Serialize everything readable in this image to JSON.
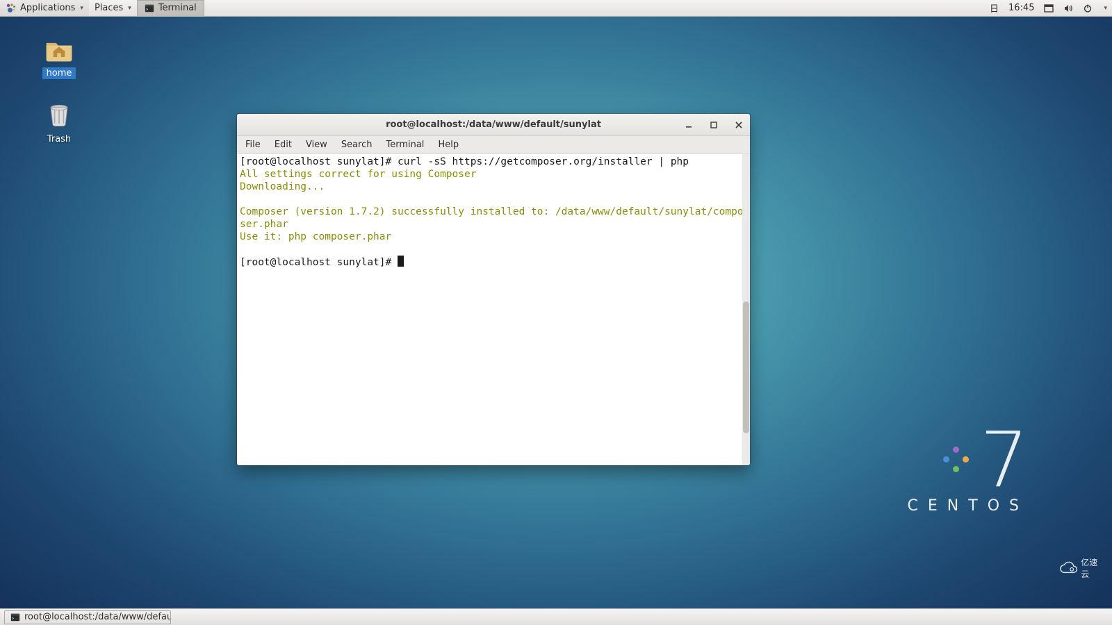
{
  "panel": {
    "applications": "Applications",
    "places": "Places",
    "top_task": "Terminal",
    "calendar_icon": "日",
    "clock": "16:45"
  },
  "desktop": {
    "home": "home",
    "trash": "Trash"
  },
  "brand": {
    "seven": "7",
    "name": "CENTOS"
  },
  "watermark": "亿速云",
  "window": {
    "title": "root@localhost:/data/www/default/sunylat",
    "menus": [
      "File",
      "Edit",
      "View",
      "Search",
      "Terminal",
      "Help"
    ]
  },
  "terminal": {
    "prompt1_a": "[root@localhost sunylat]# ",
    "cmd1": "curl -sS https://getcomposer.org/installer | php",
    "ln2": "All settings correct for using Composer",
    "ln3": "Downloading...",
    "ln5": "Composer (version 1.7.2) successfully installed to: /data/www/default/sunylat/composer.phar",
    "ln6": "Use it: php composer.phar",
    "prompt2": "[root@localhost sunylat]# "
  },
  "taskbar": {
    "entry": "root@localhost:/data/www/defau..."
  }
}
